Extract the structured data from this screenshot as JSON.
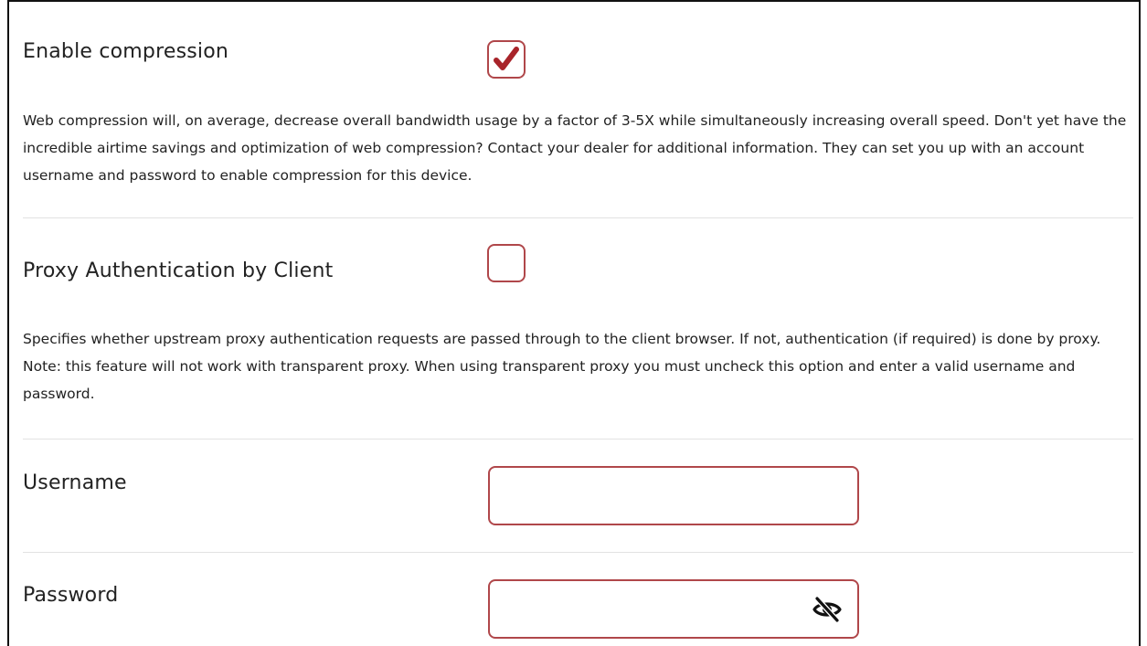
{
  "compression": {
    "label": "Enable compression",
    "checked": true,
    "description": "Web compression will, on average, decrease overall bandwidth usage by a factor of 3-5X while simultaneously increasing overall speed. Don't yet have the incredible airtime savings and optimization of web compression? Contact your dealer for additional information. They can set you up with an account username and password to enable compression for this device."
  },
  "proxy_auth": {
    "label": "Proxy Authentication by Client",
    "checked": false,
    "description": "Specifies whether upstream proxy authentication requests are passed through to the client browser. If not, authentication (if required) is done by proxy. Note: this feature will not work with transparent proxy. When using transparent proxy you must uncheck this option and enter a valid username and password."
  },
  "username": {
    "label": "Username",
    "value": ""
  },
  "password": {
    "label": "Password",
    "value": "",
    "visibility_icon": "eye-slash-icon"
  },
  "colors": {
    "accent": "#b0474a",
    "checkmark": "#a8242a",
    "divider": "#e2e2e2",
    "text": "#222222"
  }
}
